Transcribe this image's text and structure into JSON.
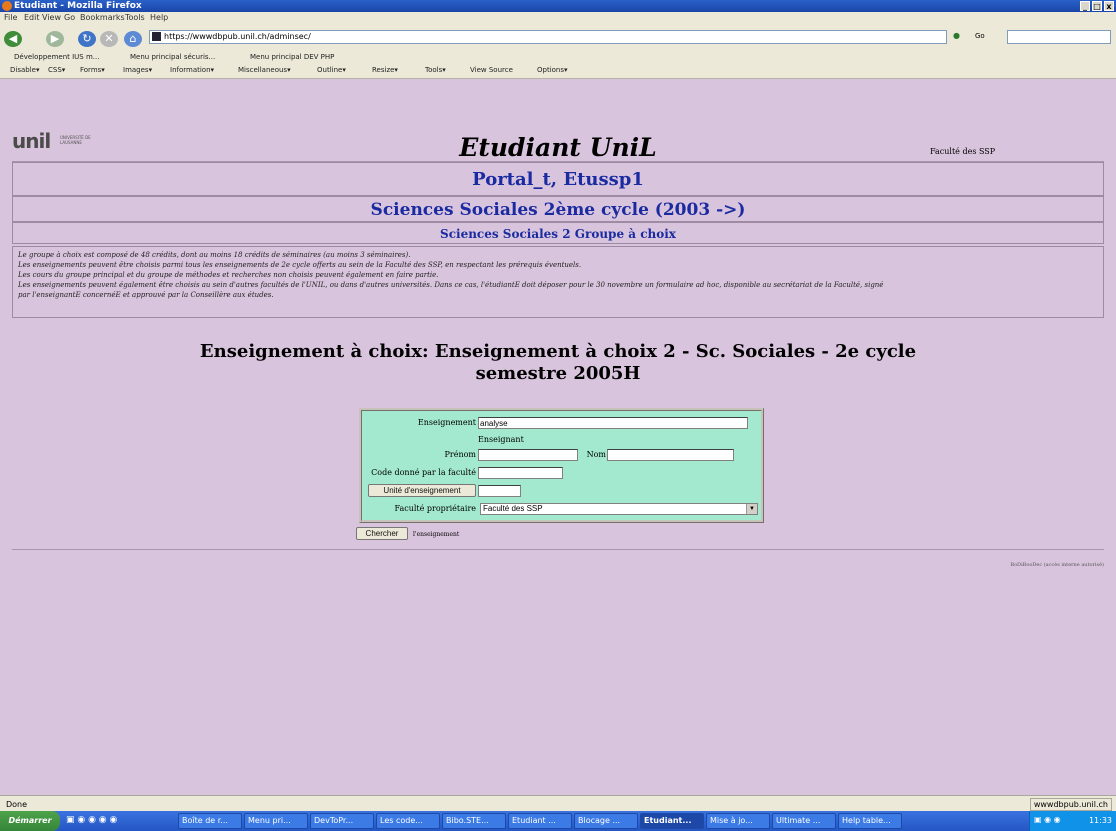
{
  "window": {
    "title": "Etudiant - Mozilla Firefox"
  },
  "menu": [
    "File",
    "Edit",
    "View",
    "Go",
    "Bookmarks",
    "Tools",
    "Help"
  ],
  "address": {
    "url": "https://wwwdbpub.unil.ch/adminsec/",
    "search_label": "Go"
  },
  "bookmarks": [
    "Développement IUS m...",
    "Menu principal sécuris...",
    "Menu principal DEV PHP"
  ],
  "devtoolbar": [
    "Disable▾",
    "CSS▾",
    "Forms▾",
    "Images▾",
    "Information▾",
    "Miscellaneous▾",
    "Outline▾",
    "Resize▾",
    "Tools▾",
    "View Source",
    "Options▾"
  ],
  "header": {
    "logo_text": "unil",
    "logo_sub": "UNIVERSITÉ DE LAUSANNE",
    "title": "Etudiant UniL",
    "faculty": "Faculté des SSP"
  },
  "boxes": {
    "user": "Portal_t, Etussp1",
    "program": "Sciences Sociales 2ème cycle (2003 ->)",
    "group": "Sciences Sociales 2 Groupe à choix"
  },
  "notes": [
    "Le groupe à choix est composé de 48 crédits, dont au moins 18 crédits de séminaires (au moins 3 séminaires).",
    "Les enseignements peuvent être choisis parmi tous les enseignements de 2e cycle offerts au sein de la Faculté des SSP, en respectant les prérequis éventuels.",
    "Les cours du groupe principal et du groupe de méthodes et recherches non choisis peuvent également en faire partie.",
    "Les enseignements peuvent également être choisis au sein d'autres facultés de l'UNIL, ou dans d'autres universités. Dans ce cas, l'étudiantE doit déposer pour le 30 novembre un formulaire ad hoc, disponible au secrétariat de la Faculté, signé",
    "par l'enseignantE concernéE et approuvé par la Conseillère aux études."
  ],
  "section": {
    "line1": "Enseignement à choix: Enseignement à choix 2 - Sc. Sociales - 2e cycle",
    "line2": "semestre 2005H"
  },
  "form": {
    "enseignement_label": "Enseignement",
    "enseignement_value": "analyse",
    "enseignant_label": "Enseignant",
    "prenom_label": "Prénom",
    "nom_label": "Nom",
    "code_label": "Code donné par la faculté",
    "unite_button": "Unité d'enseignement",
    "faculte_label": "Faculté propriétaire",
    "faculte_value": "Faculté des SSP",
    "search_button": "Chercher",
    "search_hint": "l'enseignement"
  },
  "footer": {
    "text": "BoDiBooDec (accès interne autorisé)"
  },
  "status": {
    "text": "Done",
    "host": "wwwdbpub.unil.ch"
  },
  "taskbar": {
    "start": "Démarrer",
    "tasks": [
      "Boîte de r...",
      "Menu pri...",
      "DevToPr...",
      "Les code...",
      "Bibo.STE...",
      "Etudiant ...",
      "Blocage ...",
      "Etudiant...",
      "Mise à jo...",
      "Ultimate ...",
      "Help table..."
    ],
    "active_index": 7,
    "clock": "11:33"
  }
}
